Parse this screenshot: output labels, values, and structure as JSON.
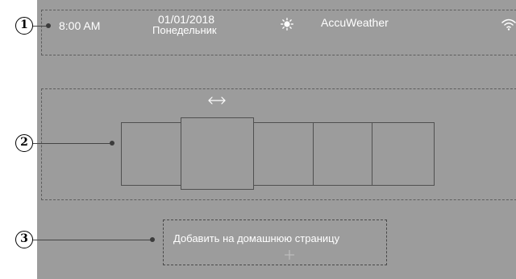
{
  "status_bar": {
    "time": "8:00 AM",
    "date": "01/01/2018",
    "weekday": "Понедельник",
    "weather_icon": "sun-icon",
    "weather_provider": "AccuWeather",
    "wifi_icon": "wifi-icon"
  },
  "widget_area": {
    "drag_icon": "left-right-arrow-icon",
    "tile_count": 5,
    "selected_tile": 2
  },
  "add_area": {
    "label": "Добавить на домашнюю страницу",
    "add_icon": "plus-icon"
  },
  "callouts": [
    {
      "label": "1"
    },
    {
      "label": "2"
    },
    {
      "label": "3"
    }
  ],
  "colors": {
    "screen_background": "#9c9c9c",
    "text": "#ffffff",
    "dashed_border": "#5e5e5e"
  }
}
